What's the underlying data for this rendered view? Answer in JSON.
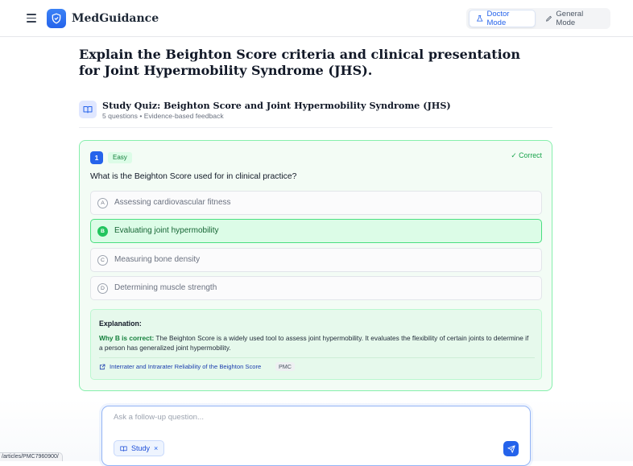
{
  "header": {
    "brand": "MedGuidance",
    "modes": {
      "doctor": "Doctor Mode",
      "general": "General Mode"
    },
    "active_mode": "doctor",
    "accent": "#2563eb"
  },
  "question": "Explain the Beighton Score criteria and clinical presentation for Joint Hypermobility Syndrome (JHS).",
  "quiz": {
    "title": "Study Quiz: Beighton Score and Joint Hypermobility Syndrome (JHS)",
    "meta": "5 questions • Evidence-based feedback",
    "item": {
      "number": "1",
      "difficulty": "Easy",
      "status": "Correct",
      "text": "What is the Beighton Score used for in clinical practice?",
      "options": [
        {
          "letter": "A",
          "text": "Assessing cardiovascular fitness"
        },
        {
          "letter": "B",
          "text": "Evaluating joint hypermobility"
        },
        {
          "letter": "C",
          "text": "Measuring bone density"
        },
        {
          "letter": "D",
          "text": "Determining muscle strength"
        }
      ],
      "selected": "B",
      "explanation": {
        "title": "Explanation:",
        "lead": "Why B is correct:",
        "body": " The Beighton Score is a widely used tool to assess joint hypermobility. It evaluates the flexibility of certain joints to determine if a person has generalized joint hypermobility.",
        "reference": {
          "title": "Interrater and Intrarater Reliability of the Beighton Score",
          "source": "PMC"
        }
      }
    }
  },
  "composer": {
    "placeholder": "Ask a follow-up question...",
    "chip_label": "Study",
    "chip_remove": "×"
  },
  "status_url": "/articles/PMC7960900/",
  "colors": {
    "correct_green": "#16a34a",
    "card_border": "#86efac"
  }
}
